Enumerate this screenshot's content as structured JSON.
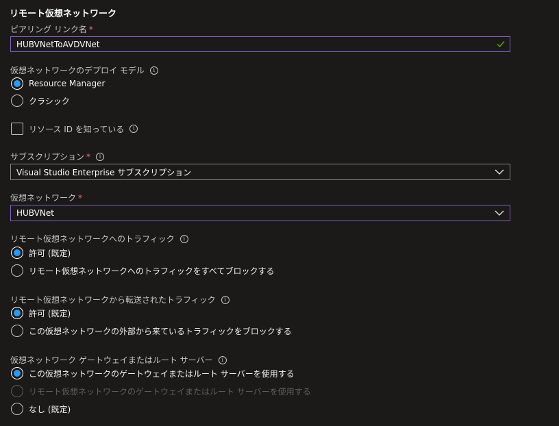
{
  "section_title": "リモート仮想ネットワーク",
  "peering_link": {
    "label": "ピアリング リンク名",
    "required_mark": "*",
    "value": "HUBVNetToAVDVNet"
  },
  "deployment_model": {
    "label": "仮想ネットワークのデプロイ モデル",
    "options": [
      {
        "label": "Resource Manager",
        "checked": true
      },
      {
        "label": "クラシック",
        "checked": false
      }
    ]
  },
  "resource_id_checkbox": {
    "label": "リソース ID を知っている",
    "checked": false
  },
  "subscription": {
    "label": "サブスクリプション",
    "required_mark": "*",
    "value": "Visual Studio Enterprise サブスクリプション"
  },
  "virtual_network": {
    "label": "仮想ネットワーク",
    "required_mark": "*",
    "value": "HUBVNet"
  },
  "traffic_to_remote": {
    "label": "リモート仮想ネットワークへのトラフィック",
    "options": [
      {
        "label": "許可 (既定)",
        "checked": true
      },
      {
        "label": "リモート仮想ネットワークへのトラフィックをすべてブロックする",
        "checked": false
      }
    ]
  },
  "forwarded_traffic": {
    "label": "リモート仮想ネットワークから転送されたトラフィック",
    "options": [
      {
        "label": "許可 (既定)",
        "checked": true
      },
      {
        "label": "この仮想ネットワークの外部から来ているトラフィックをブロックする",
        "checked": false
      }
    ]
  },
  "gateway": {
    "label": "仮想ネットワーク ゲートウェイまたはルート サーバー",
    "options": [
      {
        "label": "この仮想ネットワークのゲートウェイまたはルート サーバーを使用する",
        "checked": true,
        "disabled": false
      },
      {
        "label": "リモート仮想ネットワークのゲートウェイまたはルート サーバーを使用する",
        "checked": false,
        "disabled": true
      },
      {
        "label": "なし (既定)",
        "checked": false,
        "disabled": false
      }
    ]
  },
  "colors": {
    "background": "#1b1a19",
    "focus_border": "#8661c5",
    "radio_selected": "#2899f5",
    "required": "#f1707b",
    "valid_check": "#57a300"
  },
  "icons": {
    "info": "info-icon",
    "valid": "checkmark-icon",
    "dropdown": "chevron-down-icon"
  }
}
